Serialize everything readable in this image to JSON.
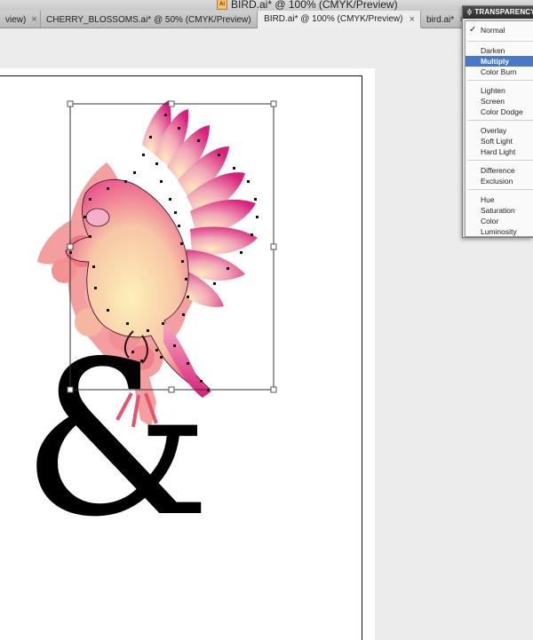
{
  "window": {
    "title": "BIRD.ai* @ 100% (CMYK/Preview)",
    "doc_icon": "Ai"
  },
  "tabs": [
    {
      "label": "view)",
      "close": "×"
    },
    {
      "label": "CHERRY_BLOSSOMS.ai* @ 50% (CMYK/Preview)",
      "close": "×"
    },
    {
      "label": "BIRD.ai* @ 100% (CMYK/Preview)",
      "close": "×",
      "active": true
    },
    {
      "label": "bird.ai*",
      "close": "×"
    }
  ],
  "artwork": {
    "ampersand": "&"
  },
  "transparency_panel": {
    "title": "≑ TRANSPARENCY",
    "check": "✓",
    "modes": [
      "Normal",
      "Darken",
      "Multiply",
      "Color Burn",
      "Lighten",
      "Screen",
      "Color Dodge",
      "Overlay",
      "Soft Light",
      "Hard Light",
      "Difference",
      "Exclusion",
      "Hue",
      "Saturation",
      "Color",
      "Luminosity"
    ],
    "selected": "Multiply",
    "checked": "Normal",
    "colors": {
      "header": "#3a3a3a",
      "highlight": "#4a78c8"
    }
  }
}
